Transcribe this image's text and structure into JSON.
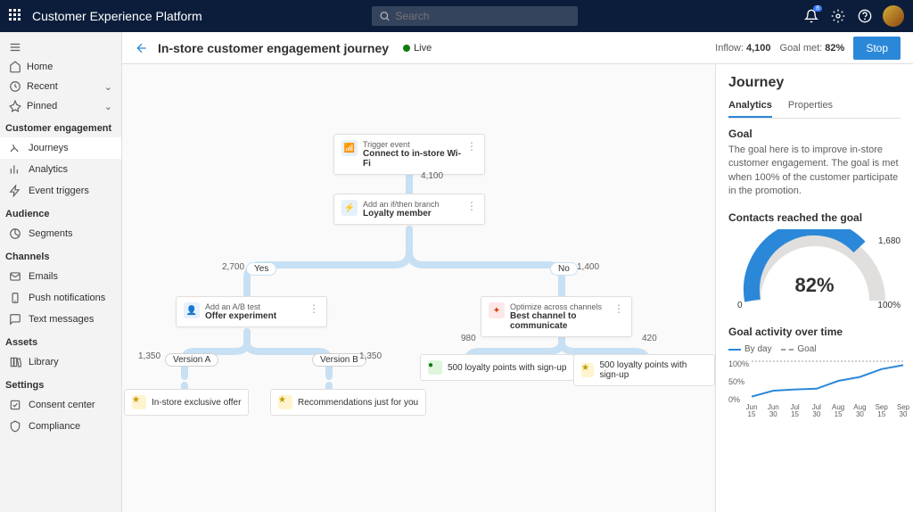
{
  "app": {
    "name": "Customer Experience Platform"
  },
  "search": {
    "placeholder": "Search"
  },
  "topbar": {
    "notification_badge": "8"
  },
  "nav": {
    "home": "Home",
    "recent": "Recent",
    "pinned": "Pinned",
    "sections": [
      {
        "title": "Customer engagement",
        "items": [
          "Journeys",
          "Analytics",
          "Event triggers"
        ],
        "active_index": 0
      },
      {
        "title": "Audience",
        "items": [
          "Segments"
        ]
      },
      {
        "title": "Channels",
        "items": [
          "Emails",
          "Push notifications",
          "Text messages"
        ]
      },
      {
        "title": "Assets",
        "items": [
          "Library"
        ]
      },
      {
        "title": "Settings",
        "items": [
          "Consent center",
          "Compliance"
        ]
      }
    ]
  },
  "header": {
    "title": "In-store customer engagement journey",
    "status": "Live",
    "inflow_label": "Inflow:",
    "inflow_value": "4,100",
    "goal_met_label": "Goal met:",
    "goal_met_value": "82%",
    "stop": "Stop"
  },
  "canvas": {
    "trigger": {
      "tag": "Trigger event",
      "label": "Connect to in-store Wi-Fi"
    },
    "count_top": "4,100",
    "branch": {
      "tag": "Add an if/then branch",
      "label": "Loyalty member"
    },
    "yes": "Yes",
    "no": "No",
    "yes_count": "2,700",
    "no_count": "1,400",
    "ab": {
      "tag": "Add an A/B test",
      "label": "Offer experiment"
    },
    "opt": {
      "tag": "Optimize across channels",
      "label": "Best channel to communicate"
    },
    "version_a": "Version A",
    "version_b": "Version B",
    "ab_a_count": "1,350",
    "ab_b_count": "1,350",
    "opt_left_count": "980",
    "opt_right_count": "420",
    "chip_a": "In-store exclusive offer",
    "chip_b": "Recommendations just for you",
    "chip_c": "500 loyalty points with sign-up",
    "chip_d": "500 loyalty points with sign-up"
  },
  "panel": {
    "title": "Journey",
    "tab_analytics": "Analytics",
    "tab_properties": "Properties",
    "goal_title": "Goal",
    "goal_text": "The goal here is to improve in-store customer engagement. The goal is met when 100% of the customer participate in the promotion.",
    "gauge_title": "Contacts reached the goal",
    "gauge_min": "0",
    "gauge_max": "100%",
    "gauge_val": "1,680",
    "gauge_pct": "82%",
    "activity_title": "Goal activity over time",
    "legend_day": "By day",
    "legend_goal": "Goal"
  },
  "chart_data": {
    "type": "line",
    "title": "Goal activity over time",
    "xlabel": "",
    "ylabel": "",
    "ylim": [
      0,
      100
    ],
    "categories": [
      "Jun 15",
      "Jun 30",
      "Jul 15",
      "Jul 30",
      "Aug 15",
      "Aug 30",
      "Sep 15",
      "Sep 30"
    ],
    "series": [
      {
        "name": "By day",
        "values": [
          10,
          25,
          28,
          30,
          50,
          60,
          80,
          90
        ]
      },
      {
        "name": "Goal",
        "values": [
          100,
          100,
          100,
          100,
          100,
          100,
          100,
          100
        ]
      }
    ]
  }
}
